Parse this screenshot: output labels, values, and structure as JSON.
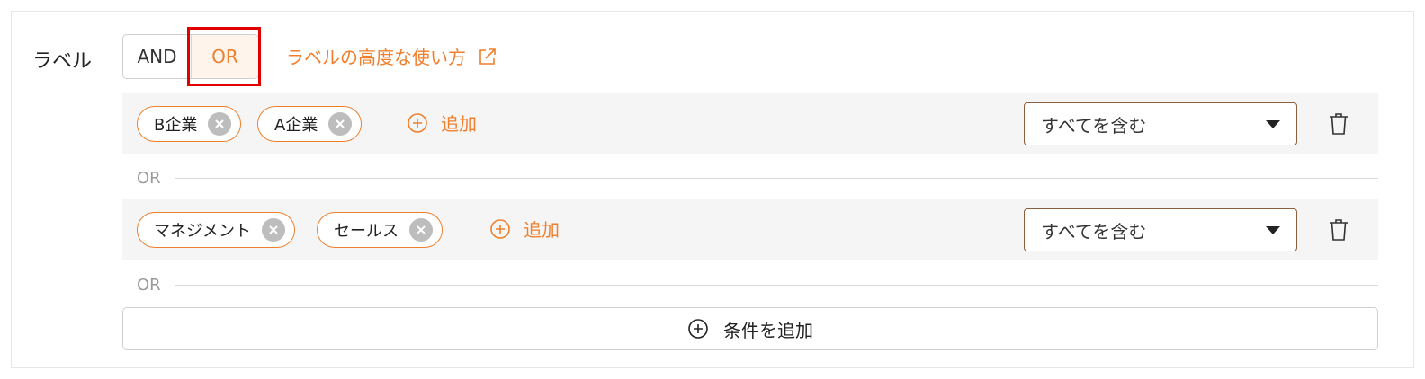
{
  "filter": {
    "label": "ラベル",
    "operators": [
      "AND",
      "OR"
    ],
    "selected_operator": "OR",
    "help_link": "ラベルの高度な使い方"
  },
  "conditions": [
    {
      "chips": [
        "B企業",
        "A企業"
      ],
      "add_label": "追加",
      "match_mode": "すべてを含む"
    },
    {
      "chips": [
        "マネジメント",
        "セールス"
      ],
      "add_label": "追加",
      "match_mode": "すべてを含む"
    }
  ],
  "separators": [
    "OR",
    "OR"
  ],
  "add_condition_label": "条件を追加",
  "colors": {
    "accent": "#ef7f2d",
    "highlight": "#e00000",
    "row_bg": "#f5f5f5",
    "select_border": "#8b5e3c"
  },
  "icons": {
    "help": "external-link-icon",
    "chip_remove": "close-circle-icon",
    "add": "plus-circle-icon",
    "dropdown": "caret-down-icon",
    "delete": "trash-icon"
  }
}
